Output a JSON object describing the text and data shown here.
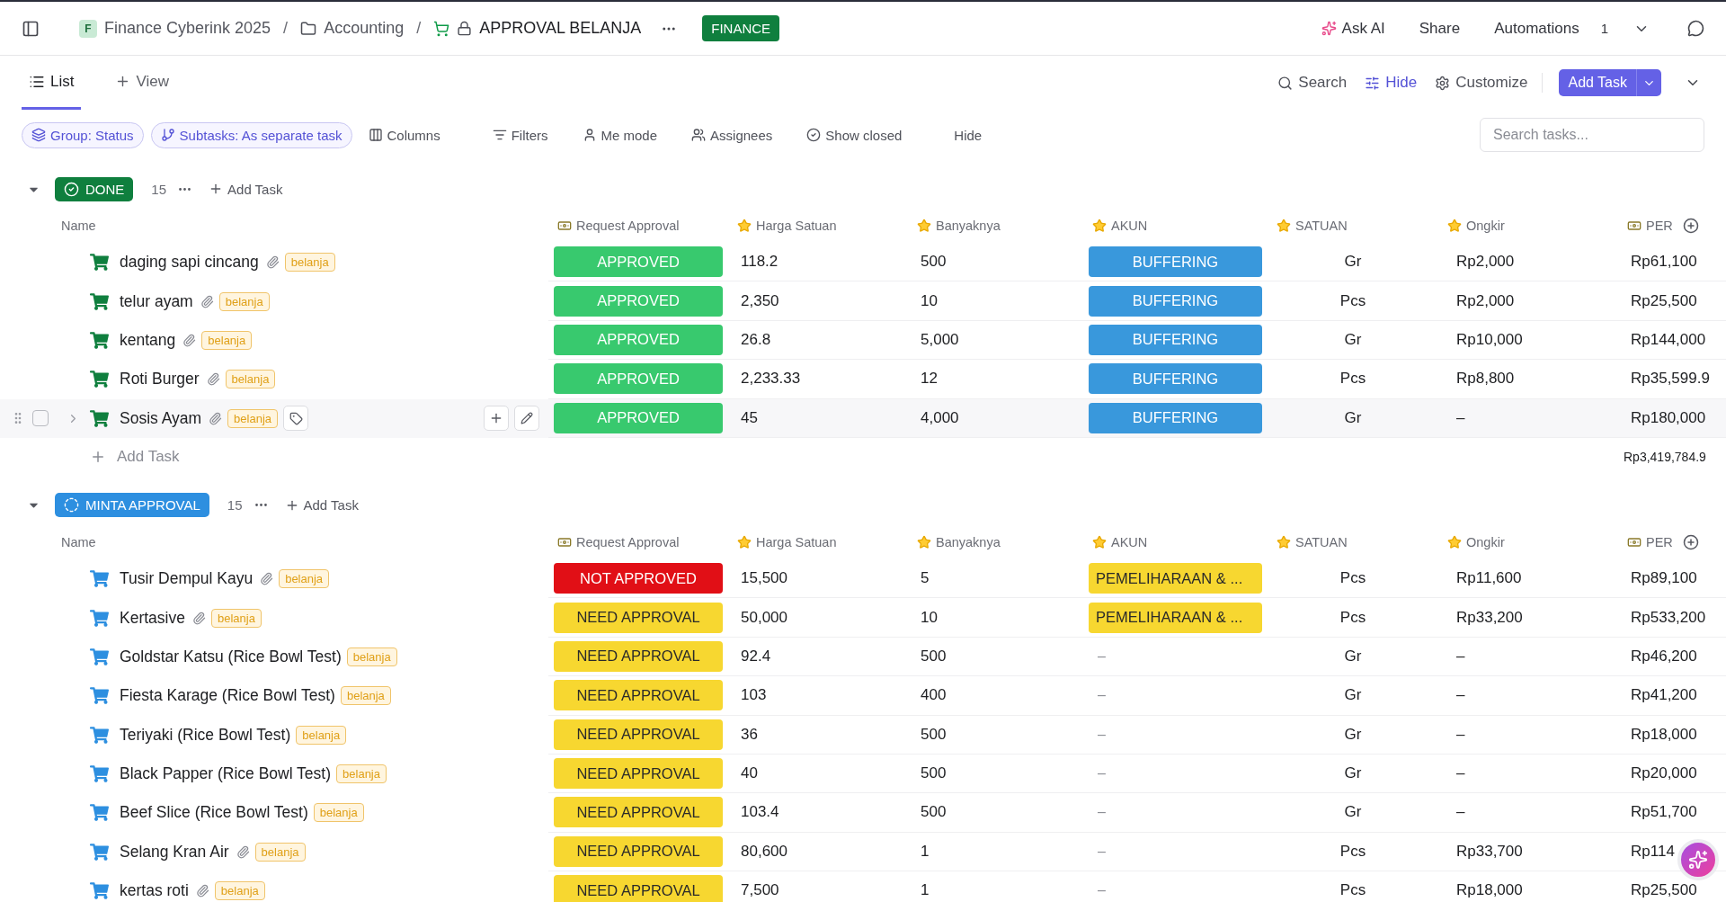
{
  "topbar": {
    "breadcrumbs": [
      {
        "kind": "space",
        "avatar": "F",
        "label": "Finance Cyberink 2025"
      },
      {
        "kind": "folder",
        "label": "Accounting"
      },
      {
        "kind": "list",
        "label": "APPROVAL BELANJA"
      }
    ],
    "separator": "/",
    "badge": "FINANCE",
    "actions": [
      {
        "kind": "ai",
        "label": "Ask AI"
      },
      {
        "kind": "plain",
        "label": "Share"
      },
      {
        "kind": "plain",
        "label": "Automations"
      }
    ],
    "automation_count": "1"
  },
  "views": {
    "tabs": [
      {
        "kind": "list",
        "label": "List",
        "selected": true
      },
      {
        "kind": "add",
        "label": "View",
        "selected": false
      }
    ],
    "tools": [
      {
        "kind": "search",
        "label": "Search",
        "active": false
      },
      {
        "kind": "hide",
        "label": "Hide",
        "active": true
      },
      {
        "kind": "settings",
        "label": "Customize",
        "active": false
      }
    ],
    "add_button": "Add Task"
  },
  "toolbar": {
    "chips": [
      {
        "kind": "group",
        "label": "Group: Status"
      },
      {
        "kind": "subtasks",
        "label": "Subtasks: As separate task"
      }
    ],
    "buttons": [
      {
        "kind": "columns",
        "label": "Columns"
      },
      {
        "kind": "filters",
        "label": "Filters"
      },
      {
        "kind": "me",
        "label": "Me mode"
      },
      {
        "kind": "assignees",
        "label": "Assignees"
      },
      {
        "kind": "closed",
        "label": "Show closed"
      },
      {
        "kind": "none",
        "label": "Hide"
      }
    ],
    "search": {
      "placeholder": "Search tasks..."
    }
  },
  "groups": [
    {
      "status": "DONE",
      "kind": "done",
      "color": "#0f7f3e",
      "count": "15",
      "add_label": "Add Task",
      "columns": [
        {
          "kind": "name",
          "label": "Name"
        },
        {
          "kind": "money",
          "label": "Request Approval"
        },
        {
          "kind": "star",
          "label": "Harga Satuan"
        },
        {
          "kind": "star",
          "label": "Banyaknya"
        },
        {
          "kind": "star",
          "label": "AKUN"
        },
        {
          "kind": "star",
          "label": "SATUAN"
        },
        {
          "kind": "star",
          "label": "Ongkir"
        },
        {
          "kind": "money",
          "label": "PER"
        }
      ],
      "rows": [
        {
          "name": "daging sapi cincang",
          "attachment": true,
          "tag": "belanja",
          "hovered": false,
          "approval": {
            "kind": "approved",
            "label": "APPROVED"
          },
          "harga": "118.2",
          "banyak": "500",
          "akun": {
            "kind": "buffering",
            "label": "BUFFERING"
          },
          "satuan": "Gr",
          "ongkir": "Rp2,000",
          "per": "Rp61,100"
        },
        {
          "name": "telur ayam",
          "attachment": true,
          "tag": "belanja",
          "hovered": false,
          "approval": {
            "kind": "approved",
            "label": "APPROVED"
          },
          "harga": "2,350",
          "banyak": "10",
          "akun": {
            "kind": "buffering",
            "label": "BUFFERING"
          },
          "satuan": "Pcs",
          "ongkir": "Rp2,000",
          "per": "Rp25,500"
        },
        {
          "name": "kentang",
          "attachment": true,
          "tag": "belanja",
          "hovered": false,
          "approval": {
            "kind": "approved",
            "label": "APPROVED"
          },
          "harga": "26.8",
          "banyak": "5,000",
          "akun": {
            "kind": "buffering",
            "label": "BUFFERING"
          },
          "satuan": "Gr",
          "ongkir": "Rp10,000",
          "per": "Rp144,000"
        },
        {
          "name": "Roti Burger",
          "attachment": true,
          "tag": "belanja",
          "hovered": false,
          "approval": {
            "kind": "approved",
            "label": "APPROVED"
          },
          "harga": "2,233.33",
          "banyak": "12",
          "akun": {
            "kind": "buffering",
            "label": "BUFFERING"
          },
          "satuan": "Pcs",
          "ongkir": "Rp8,800",
          "per": "Rp35,599.9"
        },
        {
          "name": "Sosis Ayam",
          "attachment": true,
          "tag": "belanja",
          "hovered": true,
          "approval": {
            "kind": "approved",
            "label": "APPROVED"
          },
          "harga": "45",
          "banyak": "4,000",
          "akun": {
            "kind": "buffering",
            "label": "BUFFERING"
          },
          "satuan": "Gr",
          "ongkir": "–",
          "per": "Rp180,000"
        }
      ],
      "add_task_row": "Add Task",
      "total": "Rp3,419,784.9"
    },
    {
      "status": "MINTA APPROVAL",
      "kind": "progress",
      "color": "#2d8fe0",
      "count": "15",
      "add_label": "Add Task",
      "columns": [
        {
          "kind": "name",
          "label": "Name"
        },
        {
          "kind": "money",
          "label": "Request Approval"
        },
        {
          "kind": "star",
          "label": "Harga Satuan"
        },
        {
          "kind": "star",
          "label": "Banyaknya"
        },
        {
          "kind": "star",
          "label": "AKUN"
        },
        {
          "kind": "star",
          "label": "SATUAN"
        },
        {
          "kind": "star",
          "label": "Ongkir"
        },
        {
          "kind": "money",
          "label": "PER"
        }
      ],
      "rows": [
        {
          "name": "Tusir Dempul Kayu",
          "attachment": true,
          "tag": "belanja",
          "hovered": false,
          "approval": {
            "kind": "rejected",
            "label": "NOT APPROVED"
          },
          "harga": "15,500",
          "banyak": "5",
          "akun": {
            "kind": "maintenance",
            "label": "PEMELIHARAAN & ..."
          },
          "satuan": "Pcs",
          "ongkir": "Rp11,600",
          "per": "Rp89,100"
        },
        {
          "name": "Kertasive",
          "attachment": true,
          "tag": "belanja",
          "hovered": false,
          "approval": {
            "kind": "pending",
            "label": "NEED APPROVAL"
          },
          "harga": "50,000",
          "banyak": "10",
          "akun": {
            "kind": "maintenance",
            "label": "PEMELIHARAAN & ..."
          },
          "satuan": "Pcs",
          "ongkir": "Rp33,200",
          "per": "Rp533,200"
        },
        {
          "name": "Goldstar Katsu (Rice Bowl Test)",
          "attachment": false,
          "tag": "belanja",
          "hovered": false,
          "approval": {
            "kind": "pending",
            "label": "NEED APPROVAL"
          },
          "harga": "92.4",
          "banyak": "500",
          "akun": {
            "kind": "empty",
            "label": "–"
          },
          "satuan": "Gr",
          "ongkir": "–",
          "per": "Rp46,200"
        },
        {
          "name": "Fiesta Karage (Rice Bowl Test)",
          "attachment": false,
          "tag": "belanja",
          "hovered": false,
          "approval": {
            "kind": "pending",
            "label": "NEED APPROVAL"
          },
          "harga": "103",
          "banyak": "400",
          "akun": {
            "kind": "empty",
            "label": "–"
          },
          "satuan": "Gr",
          "ongkir": "–",
          "per": "Rp41,200"
        },
        {
          "name": "Teriyaki (Rice Bowl Test)",
          "attachment": false,
          "tag": "belanja",
          "hovered": false,
          "approval": {
            "kind": "pending",
            "label": "NEED APPROVAL"
          },
          "harga": "36",
          "banyak": "500",
          "akun": {
            "kind": "empty",
            "label": "–"
          },
          "satuan": "Gr",
          "ongkir": "–",
          "per": "Rp18,000"
        },
        {
          "name": "Black Papper (Rice Bowl Test)",
          "attachment": false,
          "tag": "belanja",
          "hovered": false,
          "approval": {
            "kind": "pending",
            "label": "NEED APPROVAL"
          },
          "harga": "40",
          "banyak": "500",
          "akun": {
            "kind": "empty",
            "label": "–"
          },
          "satuan": "Gr",
          "ongkir": "–",
          "per": "Rp20,000"
        },
        {
          "name": "Beef Slice (Rice Bowl Test)",
          "attachment": false,
          "tag": "belanja",
          "hovered": false,
          "approval": {
            "kind": "pending",
            "label": "NEED APPROVAL"
          },
          "harga": "103.4",
          "banyak": "500",
          "akun": {
            "kind": "empty",
            "label": "–"
          },
          "satuan": "Gr",
          "ongkir": "–",
          "per": "Rp51,700"
        },
        {
          "name": "Selang Kran Air",
          "attachment": true,
          "tag": "belanja",
          "hovered": false,
          "approval": {
            "kind": "pending",
            "label": "NEED APPROVAL"
          },
          "harga": "80,600",
          "banyak": "1",
          "akun": {
            "kind": "empty",
            "label": "–"
          },
          "satuan": "Pcs",
          "ongkir": "Rp33,700",
          "per": "Rp114"
        },
        {
          "name": "kertas roti",
          "attachment": true,
          "tag": "belanja",
          "hovered": false,
          "approval": {
            "kind": "pending",
            "label": "NEED APPROVAL"
          },
          "harga": "7,500",
          "banyak": "1",
          "akun": {
            "kind": "empty",
            "label": "–"
          },
          "satuan": "Pcs",
          "ongkir": "Rp18,000",
          "per": "Rp25,500"
        }
      ]
    }
  ]
}
